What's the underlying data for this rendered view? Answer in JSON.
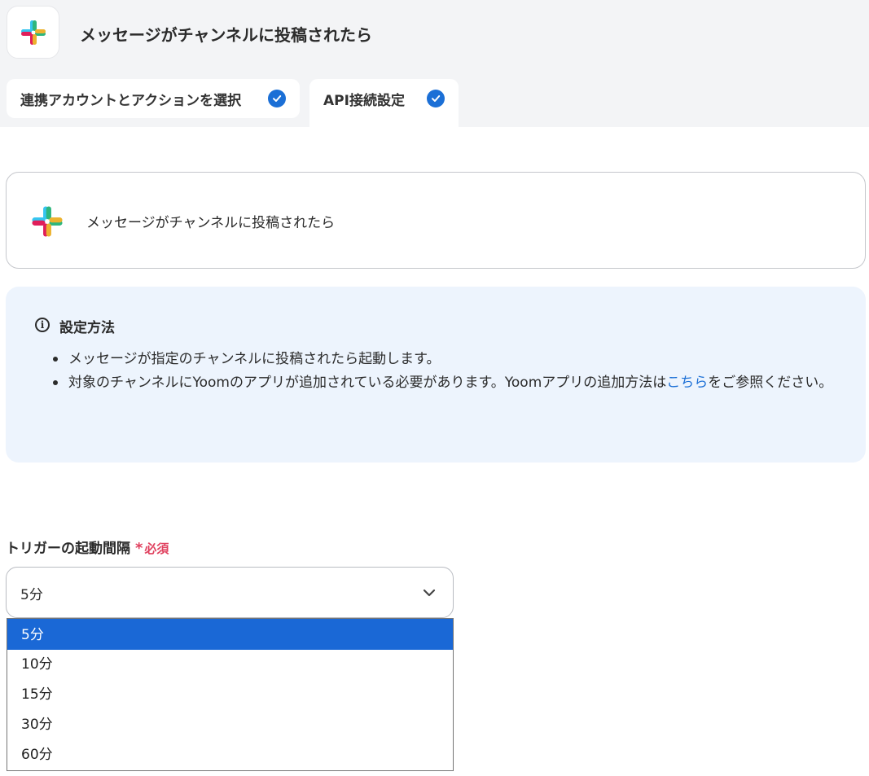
{
  "header": {
    "title": "メッセージがチャンネルに投稿されたら",
    "logo": "slack-logo"
  },
  "tabs": [
    {
      "label": "連携アカウントとアクションを選択",
      "completed": true
    },
    {
      "label": "API接続設定",
      "completed": true,
      "active": true
    }
  ],
  "trigger_card": {
    "title": "メッセージがチャンネルに投稿されたら",
    "icon": "slack-logo"
  },
  "info": {
    "icon": "info-icon",
    "title": "設定方法",
    "item1": "メッセージが指定のチャンネルに投稿されたら起動します。",
    "item2_before": "対象のチャンネルにYoomのアプリが追加されている必要があります。Yoomアプリの追加方法は",
    "item2_link": "こちら",
    "item2_after": "をご参照ください。"
  },
  "interval_field": {
    "label": "トリガーの起動間隔",
    "required_mark": "*",
    "required_text": "必須",
    "selected_value": "5分",
    "options": [
      "5分",
      "10分",
      "15分",
      "30分",
      "60分"
    ],
    "selected_index": 0
  },
  "colors": {
    "accent": "#1b6fd6",
    "required": "#e0405e",
    "info_bg": "#edf4fd",
    "header_bg": "#f3f4f6",
    "option_selected_bg": "#1a68d6"
  }
}
